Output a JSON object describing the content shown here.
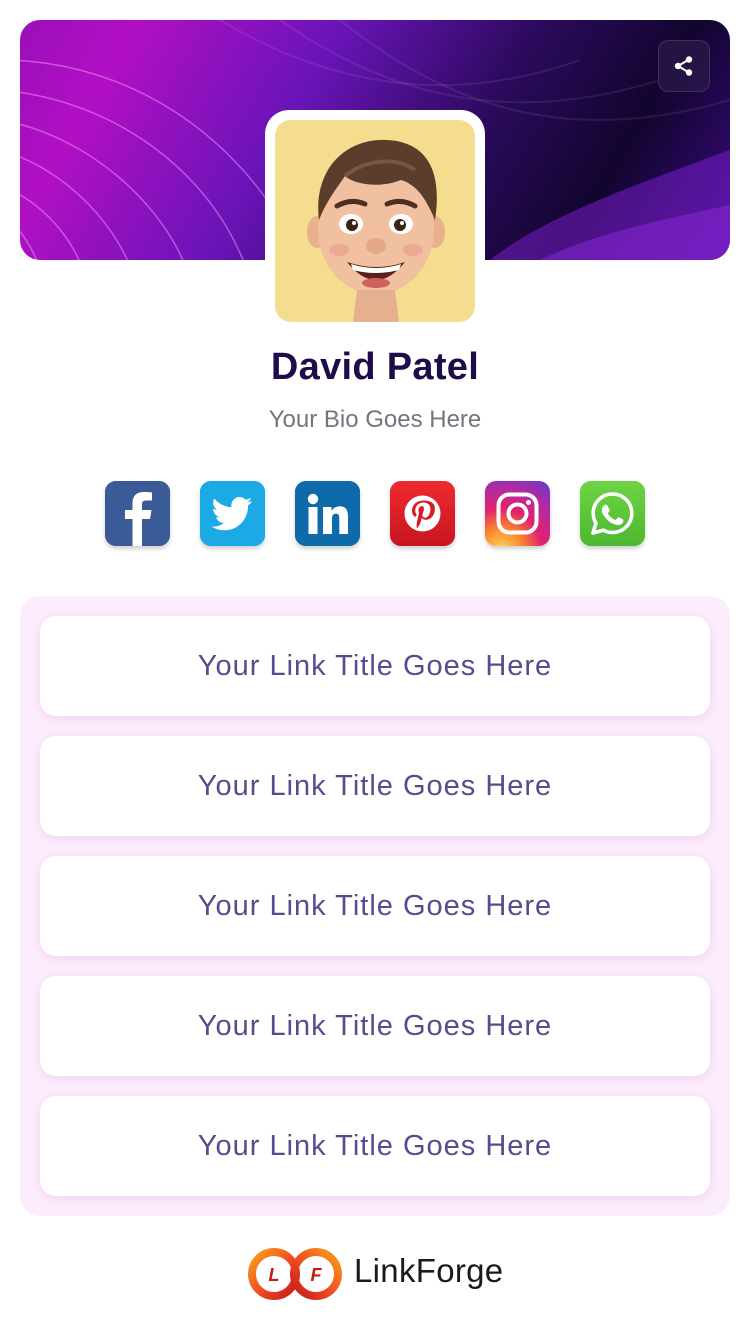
{
  "profile": {
    "name": "David Patel",
    "bio": "Your Bio Goes Here"
  },
  "header": {
    "share_icon": "share-icon"
  },
  "social": [
    {
      "name": "facebook",
      "icon": "facebook-icon",
      "color": "#3a5a98"
    },
    {
      "name": "twitter",
      "icon": "twitter-icon",
      "color": "#1da9e6"
    },
    {
      "name": "linkedin",
      "icon": "linkedin-icon",
      "color": "#0e6aa8"
    },
    {
      "name": "pinterest",
      "icon": "pinterest-icon",
      "color": "#d81c26"
    },
    {
      "name": "instagram",
      "icon": "instagram-icon",
      "color": "#c42fa8"
    },
    {
      "name": "whatsapp",
      "icon": "whatsapp-icon",
      "color": "#5ec83a"
    }
  ],
  "links": [
    {
      "label": "Your Link Title Goes Here"
    },
    {
      "label": "Your Link Title Goes Here"
    },
    {
      "label": "Your Link Title Goes Here"
    },
    {
      "label": "Your Link Title Goes Here"
    },
    {
      "label": "Your Link Title Goes Here"
    }
  ],
  "footer": {
    "brand": "LinkForge",
    "logo_letters": [
      "L",
      "F"
    ]
  },
  "colors": {
    "name_text": "#1f0c4a",
    "link_text": "#5b4a8c",
    "links_panel_bg": "#fcedfc",
    "avatar_bg": "#f4dd8e"
  }
}
